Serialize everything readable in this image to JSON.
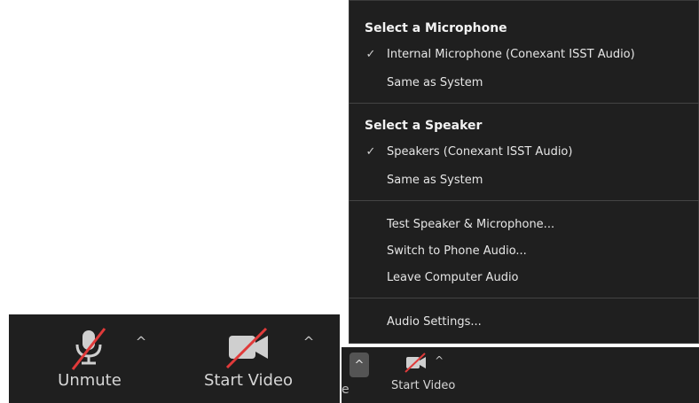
{
  "menu": {
    "microphone": {
      "title": "Select a Microphone",
      "items": [
        {
          "label": "Internal Microphone (Conexant ISST Audio)",
          "checked": "✓"
        },
        {
          "label": "Same as System",
          "checked": ""
        }
      ]
    },
    "speaker": {
      "title": "Select a Speaker",
      "items": [
        {
          "label": "Speakers (Conexant ISST Audio)",
          "checked": "✓"
        },
        {
          "label": "Same as System",
          "checked": ""
        }
      ]
    },
    "actions": [
      {
        "label": "Test Speaker & Microphone..."
      },
      {
        "label": "Switch to Phone Audio..."
      },
      {
        "label": "Leave Computer Audio"
      }
    ],
    "settings": {
      "label": "Audio Settings..."
    }
  },
  "toolbar_left": {
    "unmute_label": "Unmute",
    "start_video_label": "Start Video",
    "caret": "^"
  },
  "toolbar_right": {
    "partial_label": "e",
    "caret": "^",
    "start_video_label": "Start Video"
  },
  "colors": {
    "toolbar_bg": "#1f1f1f",
    "mute_slash": "#e03a3a",
    "icon_gray": "#cfcfcf"
  }
}
